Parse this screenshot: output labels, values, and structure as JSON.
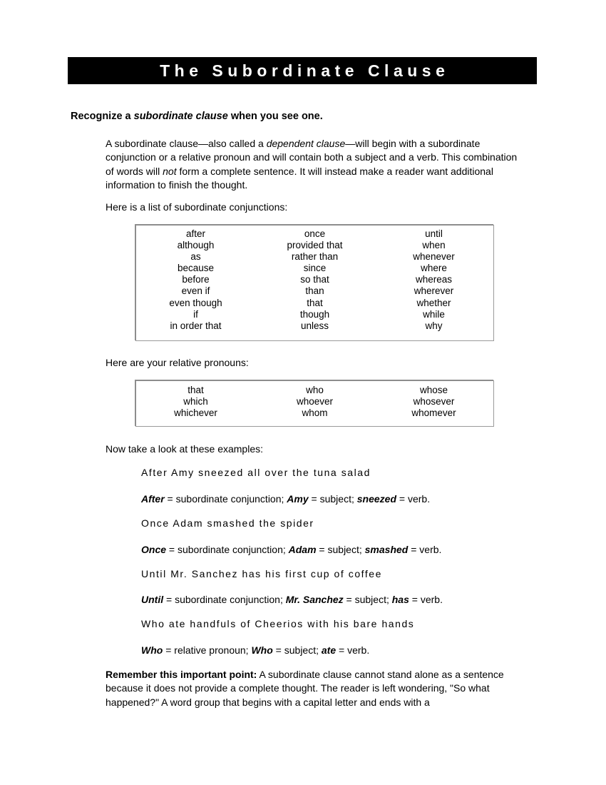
{
  "document": {
    "title": "The Subordinate Clause"
  },
  "heading": {
    "before": "Recognize a ",
    "italic": "subordinate clause",
    "after": " when you see one."
  },
  "intro": {
    "p1": "A subordinate clause—also called a ",
    "p1_italic1": "dependent clause",
    "p2": "—will begin with a subordinate conjunction or a relative pronoun and will contain both a subject and a verb. This combination of words will ",
    "p2_italic2": "not",
    "p3": " form a complete sentence. It will instead make a reader want additional information to finish the thought."
  },
  "leads": {
    "conjunctions": "Here is a list of subordinate conjunctions:",
    "pronouns": "Here are your relative pronouns:",
    "examples": "Now take a look at these examples:"
  },
  "conjunctions_table": {
    "columns": [
      [
        "after",
        "although",
        "as",
        "because",
        "before",
        "even if",
        "even though",
        "if",
        "in order that"
      ],
      [
        "once",
        "provided that",
        "rather than",
        "since",
        "so that",
        "than",
        "that",
        "though",
        "unless"
      ],
      [
        "until",
        "when",
        "whenever",
        "where",
        "whereas",
        "wherever",
        "whether",
        "while",
        "why"
      ]
    ]
  },
  "pronouns_table": {
    "columns": [
      [
        "that",
        "which",
        "whichever"
      ],
      [
        "who",
        "whoever",
        "whom"
      ],
      [
        "whose",
        "whosever",
        "whomever"
      ]
    ]
  },
  "examples": [
    {
      "sentence": "After Amy sneezed all over the tuna salad",
      "term1": "After",
      "role1": " = subordinate conjunction; ",
      "term2": "Amy",
      "role2": " = subject; ",
      "term3": "sneezed",
      "role3": " = verb."
    },
    {
      "sentence": "Once Adam smashed the spider",
      "term1": "Once",
      "role1": " = subordinate conjunction; ",
      "term2": "Adam",
      "role2": " = subject; ",
      "term3": "smashed",
      "role3": " = verb."
    },
    {
      "sentence": "Until Mr. Sanchez has his first cup of coffee",
      "term1": "Until",
      "role1": " = subordinate conjunction; ",
      "term2": "Mr. Sanchez",
      "role2": " = subject; ",
      "term3": "has",
      "role3": " = verb."
    },
    {
      "sentence": "Who ate handfuls of Cheerios with his bare hands",
      "term1": "Who",
      "role1": " = relative pronoun;  ",
      "term2": "Who",
      "role2": " = subject; ",
      "term3": "ate",
      "role3": " = verb."
    }
  ],
  "closing": {
    "bold": "Remember this important point:",
    "text": " A subordinate clause cannot stand alone as a sentence because it does not provide a complete thought. The reader is left wondering, \"So what happened?\" A word group that begins with a capital letter and ends with a"
  },
  "colors": {
    "banner_background": "#000000",
    "banner_text": "#ffffff",
    "table_border": "#9a9a9a",
    "page_background": "#ffffff",
    "body_text": "#000000"
  }
}
